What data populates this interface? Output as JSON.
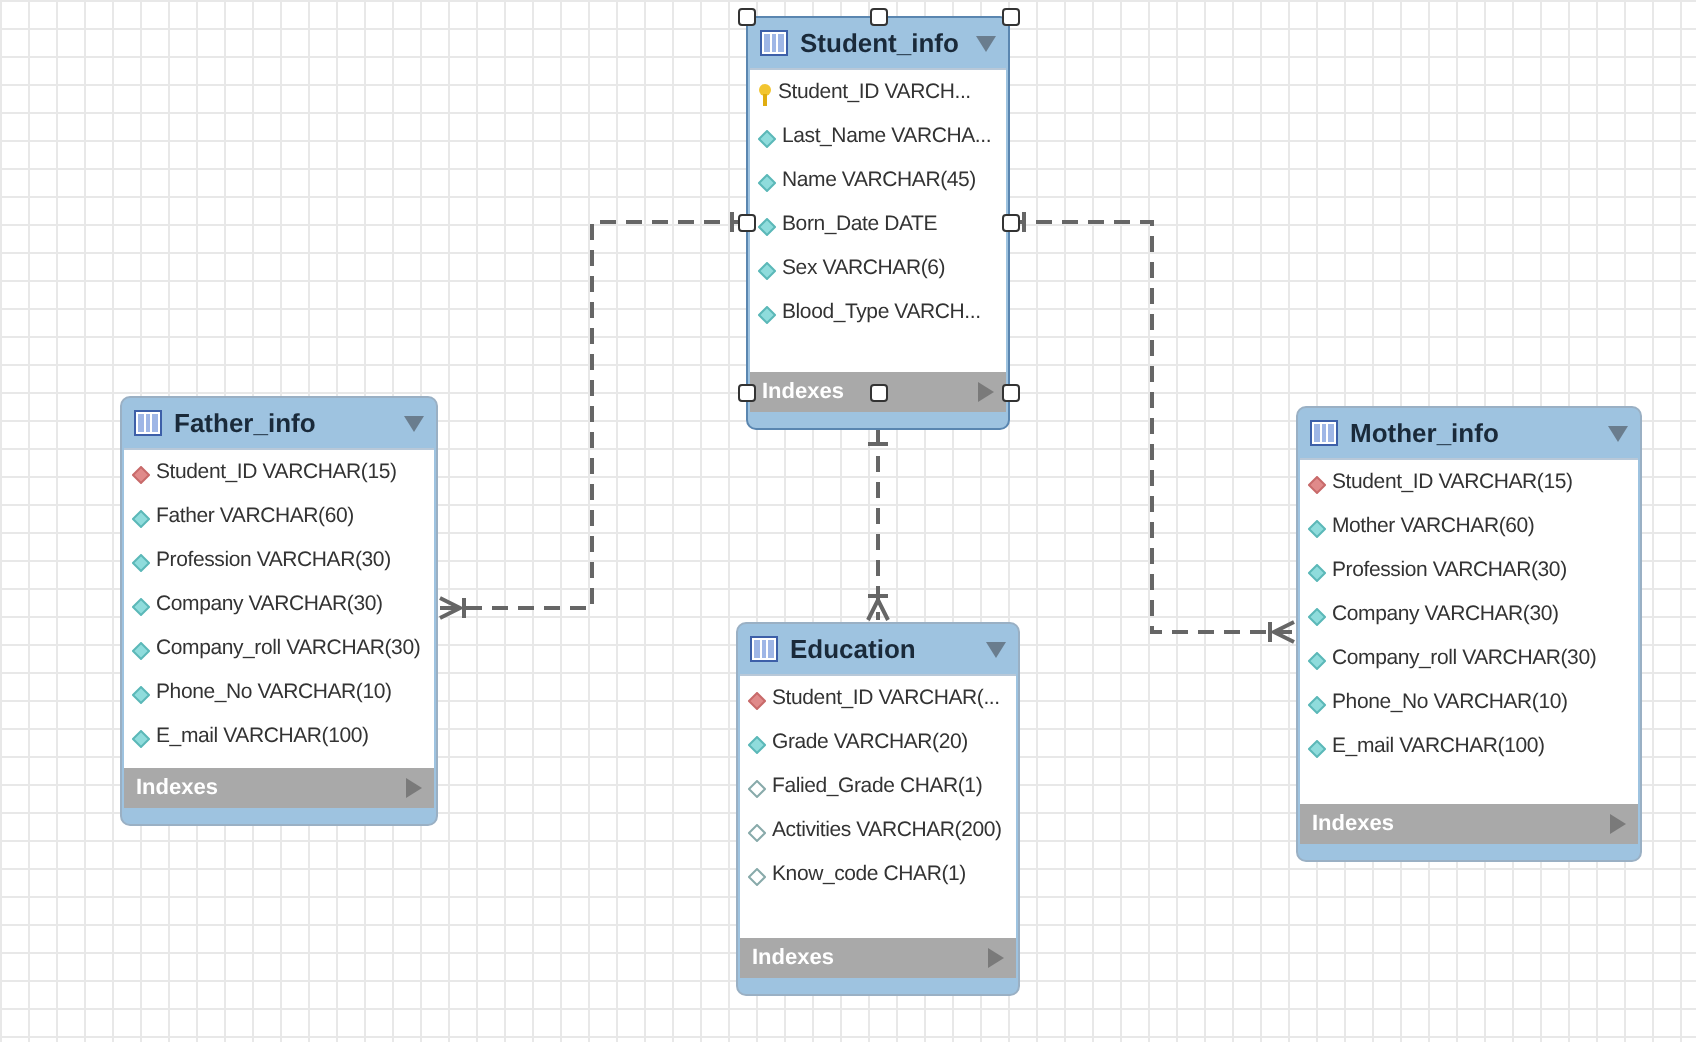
{
  "tables": [
    {
      "name": "Student_info",
      "selected": true,
      "columns": [
        {
          "text": "Student_ID VARCH...",
          "kind": "primary"
        },
        {
          "text": "Last_Name VARCHA...",
          "kind": "column"
        },
        {
          "text": "Name VARCHAR(45)",
          "kind": "column"
        },
        {
          "text": "Born_Date DATE",
          "kind": "column"
        },
        {
          "text": "Sex VARCHAR(6)",
          "kind": "column"
        },
        {
          "text": "Blood_Type VARCH...",
          "kind": "column"
        }
      ],
      "indexes": "Indexes"
    },
    {
      "name": "Father_info",
      "selected": false,
      "columns": [
        {
          "text": "Student_ID VARCHAR(15)",
          "kind": "foreign"
        },
        {
          "text": "Father VARCHAR(60)",
          "kind": "column"
        },
        {
          "text": "Profession VARCHAR(30)",
          "kind": "column"
        },
        {
          "text": "Company VARCHAR(30)",
          "kind": "column"
        },
        {
          "text": "Company_roll VARCHAR(30)",
          "kind": "column"
        },
        {
          "text": "Phone_No VARCHAR(10)",
          "kind": "column"
        },
        {
          "text": "E_mail VARCHAR(100)",
          "kind": "column"
        }
      ],
      "indexes": "Indexes"
    },
    {
      "name": "Mother_info",
      "selected": false,
      "columns": [
        {
          "text": "Student_ID VARCHAR(15)",
          "kind": "foreign"
        },
        {
          "text": "Mother VARCHAR(60)",
          "kind": "column"
        },
        {
          "text": "Profession VARCHAR(30)",
          "kind": "column"
        },
        {
          "text": "Company VARCHAR(30)",
          "kind": "column"
        },
        {
          "text": "Company_roll VARCHAR(30)",
          "kind": "column"
        },
        {
          "text": "Phone_No VARCHAR(10)",
          "kind": "column"
        },
        {
          "text": "E_mail VARCHAR(100)",
          "kind": "column"
        }
      ],
      "indexes": "Indexes"
    },
    {
      "name": "Education",
      "selected": false,
      "columns": [
        {
          "text": "Student_ID VARCHAR(...",
          "kind": "foreign"
        },
        {
          "text": "Grade VARCHAR(20)",
          "kind": "column"
        },
        {
          "text": "Falied_Grade CHAR(1)",
          "kind": "nullable"
        },
        {
          "text": "Activities VARCHAR(200)",
          "kind": "nullable"
        },
        {
          "text": "Know_code CHAR(1)",
          "kind": "nullable"
        }
      ],
      "indexes": "Indexes"
    }
  ]
}
